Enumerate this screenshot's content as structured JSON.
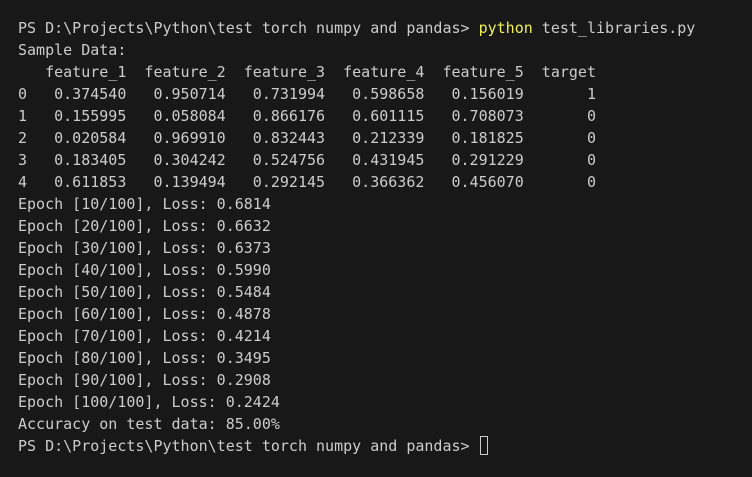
{
  "colors": {
    "background": "#181818",
    "foreground": "#cccccc",
    "command": "#f1f15a"
  },
  "prompt_1": {
    "prefix": "PS D:\\Projects\\Python\\test torch numpy and pandas> ",
    "command": "python",
    "args": " test_libraries.py"
  },
  "output": {
    "sample_title": "Sample Data:",
    "table_header": "   feature_1  feature_2  feature_3  feature_4  feature_5  target",
    "table_rows": [
      "0   0.374540   0.950714   0.731994   0.598658   0.156019       1",
      "1   0.155995   0.058084   0.866176   0.601115   0.708073       0",
      "2   0.020584   0.969910   0.832443   0.212339   0.181825       0",
      "3   0.183405   0.304242   0.524756   0.431945   0.291229       0",
      "4   0.611853   0.139494   0.292145   0.366362   0.456070       0"
    ],
    "epochs": [
      "Epoch [10/100], Loss: 0.6814",
      "Epoch [20/100], Loss: 0.6632",
      "Epoch [30/100], Loss: 0.6373",
      "Epoch [40/100], Loss: 0.5990",
      "Epoch [50/100], Loss: 0.5484",
      "Epoch [60/100], Loss: 0.4878",
      "Epoch [70/100], Loss: 0.4214",
      "Epoch [80/100], Loss: 0.3495",
      "Epoch [90/100], Loss: 0.2908",
      "Epoch [100/100], Loss: 0.2424"
    ],
    "accuracy": "Accuracy on test data: 85.00%"
  },
  "prompt_2": {
    "prefix": "PS D:\\Projects\\Python\\test torch numpy and pandas> "
  }
}
